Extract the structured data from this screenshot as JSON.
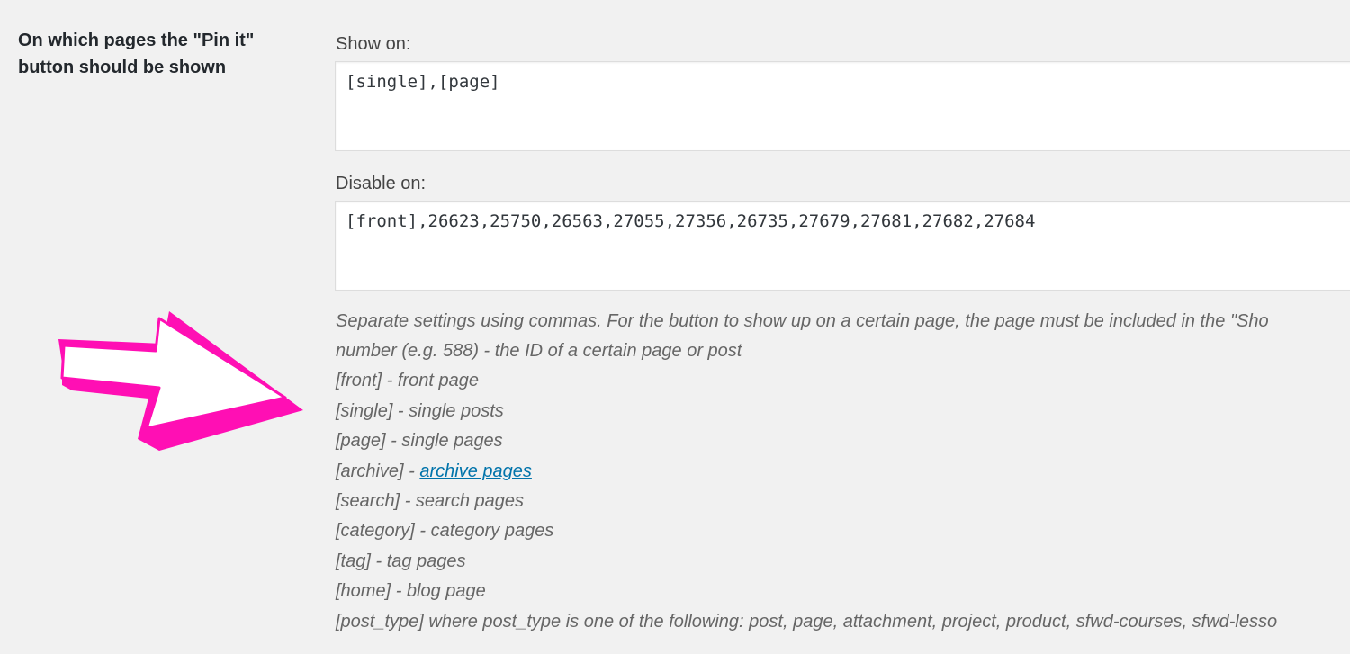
{
  "setting": {
    "label": "On which pages the \"Pin it\" button should be shown"
  },
  "show_on": {
    "label": "Show on:",
    "value": "[single],[page]"
  },
  "disable_on": {
    "label": "Disable on:",
    "value": "[front],26623,25750,26563,27055,27356,26735,27679,27681,27682,27684"
  },
  "help": {
    "intro": "Separate settings using commas. For the button to show up on a certain page, the page must be included in the \"Sho",
    "number_line": "number (e.g. 588) - the ID of a certain page or post",
    "front_line": "[front] - front page",
    "single_line": "[single] - single posts",
    "page_line": "[page] - single pages",
    "archive_prefix": "[archive] - ",
    "archive_link": "archive pages",
    "search_line": "[search] - search pages",
    "category_line": "[category] - category pages",
    "tag_line": "[tag] - tag pages",
    "home_line": "[home] - blog page",
    "post_type_line": "[post_type] where post_type is one of the following: post, page, attachment, project, product, sfwd-courses, sfwd-lesso"
  },
  "annotation": {
    "arrow_color": "#ff0fb4",
    "arrow_fill": "#ffffff",
    "icon": "pointing-arrow-icon"
  },
  "colors": {
    "background": "#f1f1f1",
    "link": "#0073aa",
    "label": "#23282d",
    "help_text": "#666666"
  }
}
